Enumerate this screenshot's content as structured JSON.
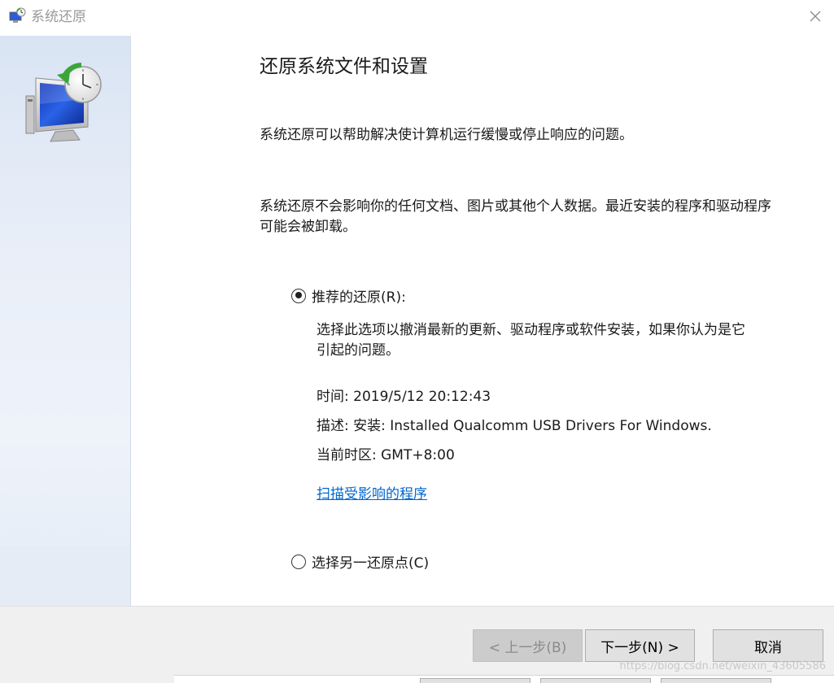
{
  "window": {
    "title": "系统还原",
    "close_icon": "close-icon"
  },
  "sidebar": {
    "hero_icon": "system-restore-icon"
  },
  "main": {
    "heading": "还原系统文件和设置",
    "intro": "系统还原可以帮助解决使计算机运行缓慢或停止响应的问题。",
    "note": "系统还原不会影响你的任何文档、图片或其他个人数据。最近安装的程序和驱动程序可能会被卸载。",
    "options": [
      {
        "label": "推荐的还原(R):",
        "selected": true,
        "description": "选择此选项以撤消最新的更新、驱动程序或软件安装，如果你认为是它引起的问题。",
        "time": "时间: 2019/5/12 20:12:43",
        "desc": "描述: 安装: Installed Qualcomm USB Drivers For Windows.",
        "timezone": "当前时区: GMT+8:00",
        "link": "扫描受影响的程序"
      },
      {
        "label": "选择另一还原点(C)",
        "selected": false
      }
    ]
  },
  "footer": {
    "back_label": "< 上一步(B)",
    "next_label": "下一步(N) >",
    "cancel_label": "取消"
  },
  "watermark": "https://blog.csdn.net/weixin_43605586",
  "colors": {
    "link": "#0066cc",
    "sidebar": "#e8eef8",
    "footer": "#f0f0f0"
  }
}
